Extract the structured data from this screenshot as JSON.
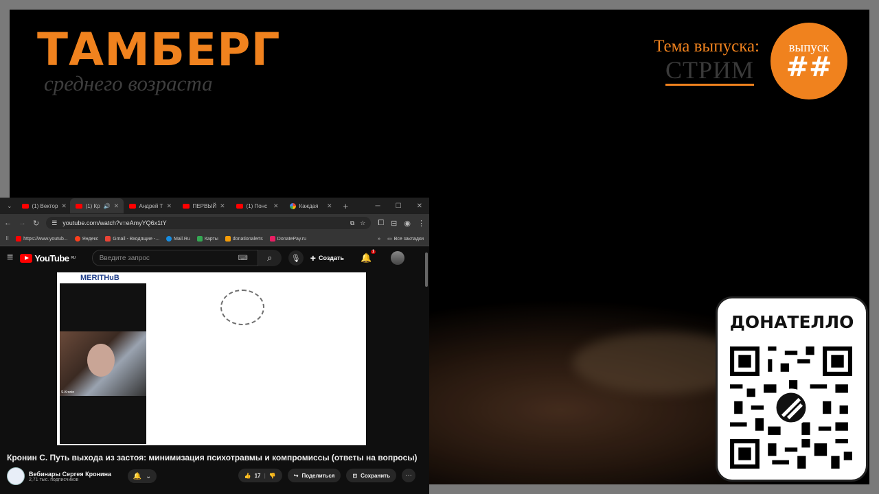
{
  "stream": {
    "brand_title": "ТАМБЕРГ",
    "brand_subtitle": "среднего возраста",
    "theme_label": "Тема выпуска:",
    "theme_value": "СТРИМ",
    "episode_label": "выпуск",
    "episode_number": "##",
    "donate_title": "ДОНАТЕЛЛО",
    "accent_color": "#f0821e"
  },
  "browser": {
    "tabs": [
      {
        "label": "(1) Вектор",
        "icon": "youtube-icon",
        "active": false
      },
      {
        "label": "(1) Кр",
        "icon": "youtube-icon",
        "active": true
      },
      {
        "label": "Андрей Т",
        "icon": "youtube-icon",
        "active": false
      },
      {
        "label": "ПЕРВЫЙ",
        "icon": "youtube-icon",
        "active": false
      },
      {
        "label": "(1) Понс",
        "icon": "youtube-icon",
        "active": false
      },
      {
        "label": "Каждая",
        "icon": "google-icon",
        "active": false
      }
    ],
    "url": "youtube.com/watch?v=eAmyYQ6x1tY",
    "bookmarks": [
      {
        "label": "https://www.youtub...",
        "color": "#ff0000"
      },
      {
        "label": "Яндекс",
        "color": "#fc3f1d"
      },
      {
        "label": "Gmail - Входящие -...",
        "color": "#ea4335"
      },
      {
        "label": "Mail.Ru",
        "color": "#168de2"
      },
      {
        "label": "Карты",
        "color": "#34a853"
      },
      {
        "label": "donationalerts",
        "color": "#f59c07"
      },
      {
        "label": "DonatePay.ru",
        "color": "#e91e63"
      }
    ],
    "all_bookmarks": "Все закладки"
  },
  "youtube": {
    "logo": "YouTube",
    "region": "RU",
    "search_placeholder": "Введите запрос",
    "create_label": "Создать",
    "notifications": "1",
    "video_overlay_brand": "MERITHuB",
    "cam_name": "S.Kronin",
    "video_title": "Кронин С. Путь выхода из застоя: минимизация психотравмы и компромиссы (ответы на вопросы)",
    "channel_name": "Вебинары Сергея Кронина",
    "subscribers": "2,71 тыс. подписчиков",
    "likes": "17",
    "share_label": "Поделиться",
    "save_label": "Сохранить"
  }
}
